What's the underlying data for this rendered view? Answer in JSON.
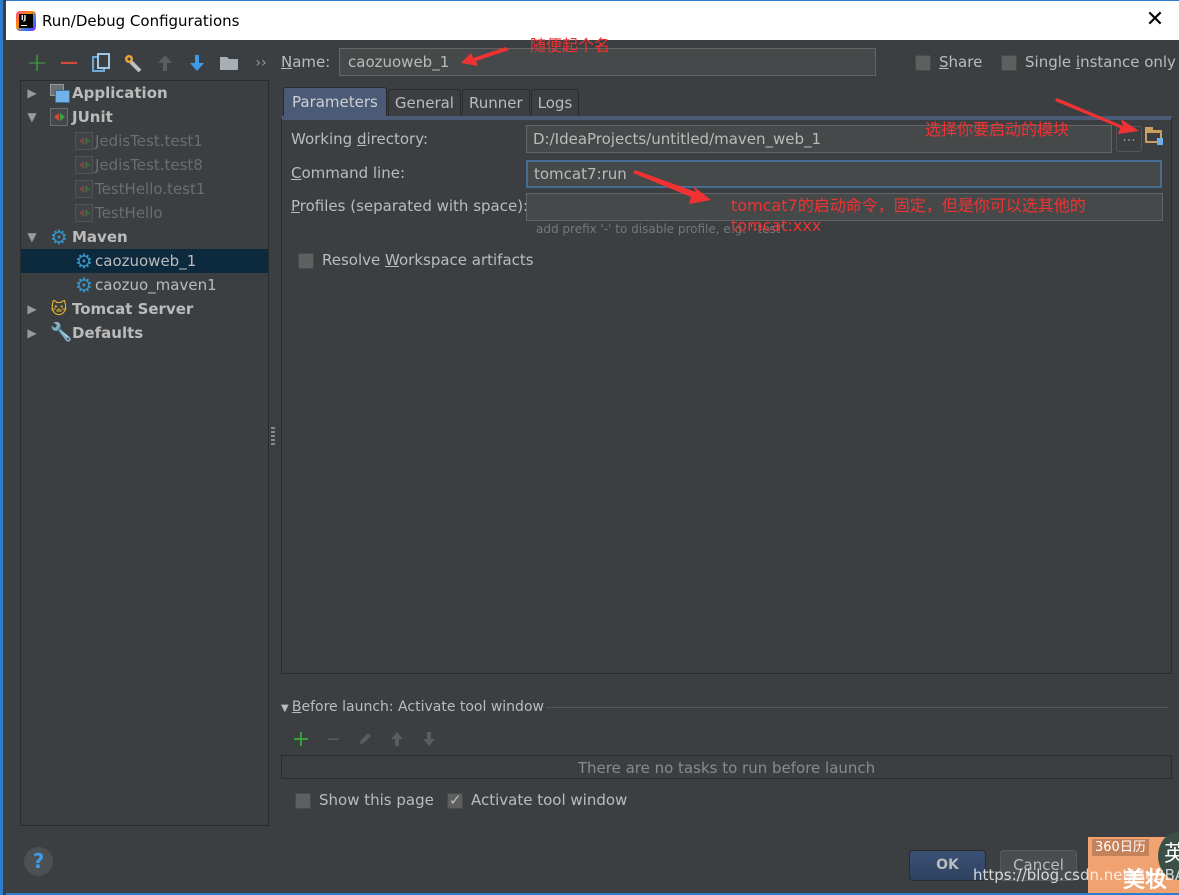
{
  "window": {
    "title": "Run/Debug Configurations",
    "close_icon": "close-icon"
  },
  "toolbar": {
    "add": "+",
    "remove": "−",
    "copy": "copy-icon",
    "edit_defaults": "wrench-icon",
    "move_up": "arrow-up-icon",
    "move_down": "arrow-down-icon",
    "folder": "folder-icon",
    "more": "››"
  },
  "tree": {
    "items": [
      {
        "label": "Application",
        "level": 0,
        "expanded": false,
        "icon": "application-icon",
        "style": "bold"
      },
      {
        "label": "JUnit",
        "level": 0,
        "expanded": true,
        "icon": "junit-icon",
        "style": "bold"
      },
      {
        "label": "JedisTest.test1",
        "level": 1,
        "icon": "junit-icon",
        "style": "dim"
      },
      {
        "label": "JedisTest.test8",
        "level": 1,
        "icon": "junit-icon",
        "style": "dim"
      },
      {
        "label": "TestHello.test1",
        "level": 1,
        "icon": "junit-icon",
        "style": "dim"
      },
      {
        "label": "TestHello",
        "level": 1,
        "icon": "junit-icon",
        "style": "dim"
      },
      {
        "label": "Maven",
        "level": 0,
        "expanded": true,
        "icon": "maven-gear-icon",
        "style": "bold"
      },
      {
        "label": "caozuoweb_1",
        "level": 1,
        "icon": "maven-gear-icon",
        "style": "normal",
        "selected": true
      },
      {
        "label": "caozuo_maven1",
        "level": 1,
        "icon": "maven-gear-icon",
        "style": "normal"
      },
      {
        "label": "Tomcat Server",
        "level": 0,
        "expanded": false,
        "icon": "tomcat-icon",
        "style": "bold"
      },
      {
        "label": "Defaults",
        "level": 0,
        "expanded": false,
        "icon": "defaults-wrench-icon",
        "style": "bold"
      }
    ]
  },
  "config": {
    "name_label_mnemonic": "N",
    "name_label_rest": "ame:",
    "name_value": "caozuoweb_1",
    "share_mnemonic": "S",
    "share_rest": "hare",
    "share_checked": false,
    "single_pre": "Single ",
    "single_mnemonic": "i",
    "single_rest": "nstance only",
    "single_checked": false
  },
  "tabs": [
    {
      "label": "Parameters",
      "active": true
    },
    {
      "label": "General",
      "active": false
    },
    {
      "label": "Runner",
      "active": false
    },
    {
      "label": "Logs",
      "active": false
    }
  ],
  "parameters": {
    "working_dir_pre": "Working ",
    "working_dir_mnemonic": "d",
    "working_dir_rest": "irectory:",
    "working_dir_value": "D:/IdeaProjects/untitled/maven_web_1",
    "command_mnemonic": "C",
    "command_rest": "ommand line:",
    "command_value": "tomcat7:run",
    "profiles_mnemonic": "P",
    "profiles_rest": "rofiles (separated with space):",
    "profiles_value": "",
    "profiles_hint": "add prefix '-' to disable profile, e.g. '-test'",
    "browse_label": "...",
    "resolve_pre": "Resolve ",
    "resolve_mnemonic": "W",
    "resolve_rest": "orkspace artifacts",
    "resolve_checked": false
  },
  "before_launch": {
    "title_mnemonic": "B",
    "title_rest": "efore launch: Activate tool window",
    "empty_text": "There are no tasks to run before launch",
    "show_page_label": "Show this page",
    "show_page_checked": false,
    "activate_label": "Activate tool window",
    "activate_checked": true
  },
  "buttons": {
    "help": "?",
    "ok": "OK",
    "cancel": "Cancel"
  },
  "annotations": {
    "name_note": "随便起个名",
    "module_note": "选择你要启动的模块",
    "command_note_line1": "tomcat7的启动命令，固定，但是你可以选其他的",
    "command_note_line2": "tomcat:xxx",
    "color": "#f03232"
  },
  "overlay": {
    "watermark": "https://blog.csdn.net/GeBBA",
    "widget_badge": "360日历",
    "widget_text": "美妆",
    "circle_text": "英"
  }
}
